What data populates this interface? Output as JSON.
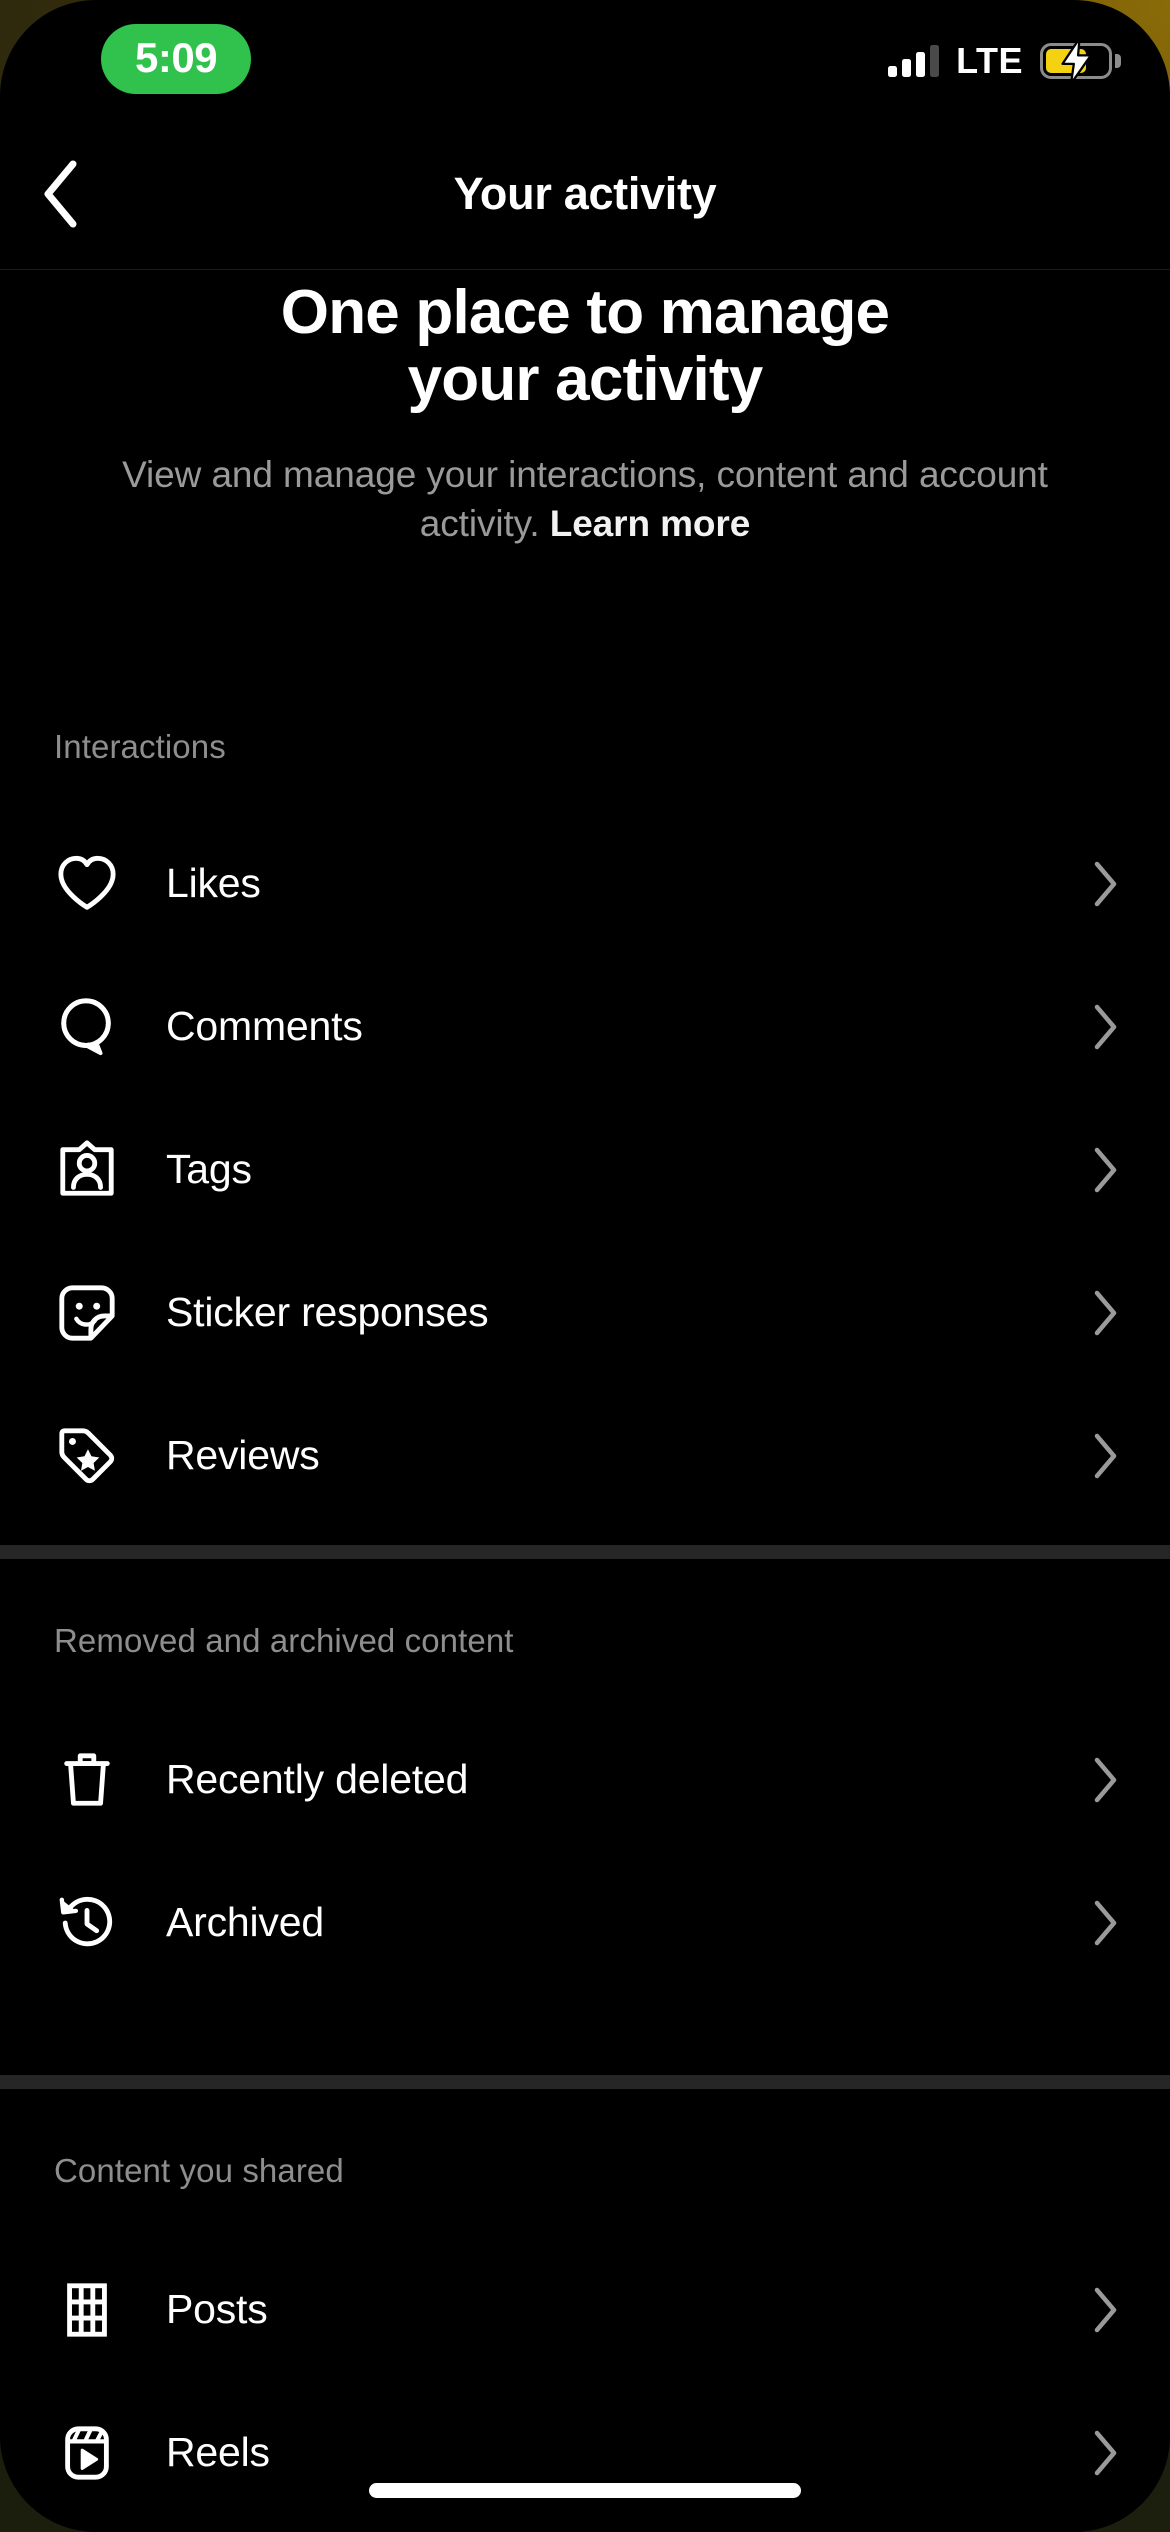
{
  "status_bar": {
    "time": "5:09",
    "time_pill_color": "#30c24d",
    "network": "LTE",
    "signal_bars_filled": 3,
    "signal_bars_total": 4,
    "battery_charging": true,
    "battery_color": "#f5d211",
    "icons": [
      "signal-icon",
      "battery-charging-icon"
    ]
  },
  "nav": {
    "title": "Your activity",
    "back_icon": "chevron-left-icon"
  },
  "hero": {
    "title": "One place to manage your activity",
    "title_line_1": "One place to manage",
    "title_line_2": "your activity",
    "subtitle": "View and manage your interactions, content and account activity.",
    "learn_more": "Learn more"
  },
  "sections": [
    {
      "id": "interactions",
      "heading": "Interactions",
      "rows": [
        {
          "label": "Likes",
          "icon": "heart-icon"
        },
        {
          "label": "Comments",
          "icon": "comment-bubble-icon"
        },
        {
          "label": "Tags",
          "icon": "tag-person-icon"
        },
        {
          "label": "Sticker responses",
          "icon": "sticker-smiley-icon"
        },
        {
          "label": "Reviews",
          "icon": "price-tag-star-icon"
        }
      ]
    },
    {
      "id": "removed-archived",
      "heading": "Removed and archived content",
      "rows": [
        {
          "label": "Recently deleted",
          "icon": "trash-icon"
        },
        {
          "label": "Archived",
          "icon": "clock-history-icon"
        }
      ]
    },
    {
      "id": "content-you-shared",
      "heading": "Content you shared",
      "rows": [
        {
          "label": "Posts",
          "icon": "grid-icon"
        },
        {
          "label": "Reels",
          "icon": "reels-play-icon"
        }
      ]
    }
  ],
  "colors": {
    "background": "#000000",
    "text_primary": "#ffffff",
    "text_secondary": "#8e8e8e",
    "divider": "#262626"
  }
}
